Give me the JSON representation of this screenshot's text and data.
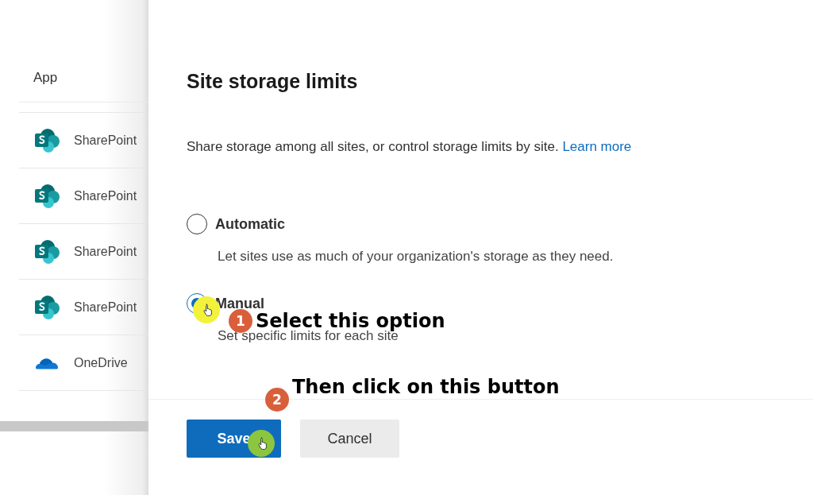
{
  "sidebar": {
    "header": "App",
    "items": [
      {
        "name": "SharePoint",
        "kind": "sharepoint"
      },
      {
        "name": "SharePoint",
        "kind": "sharepoint"
      },
      {
        "name": "SharePoint",
        "kind": "sharepoint"
      },
      {
        "name": "SharePoint",
        "kind": "sharepoint"
      },
      {
        "name": "OneDrive",
        "kind": "onedrive"
      }
    ]
  },
  "dialog": {
    "title": "Site storage limits",
    "description": "Share storage among all sites, or control storage limits by site.",
    "link": "Learn more",
    "options": [
      {
        "label": "Automatic",
        "description": "Let sites use as much of your organization's storage as they need.",
        "selected": false
      },
      {
        "label": "Manual",
        "description": "Set specific limits for each site",
        "selected": true
      }
    ],
    "buttons": [
      {
        "label": "Save",
        "kind": "primary"
      },
      {
        "label": "Cancel",
        "kind": "secondary"
      }
    ]
  },
  "annotations": [
    {
      "number": "1",
      "text": "Select this option",
      "color": "#f2f23a"
    },
    {
      "number": "2",
      "text": "Then click on this button",
      "color": "#8cc63f"
    }
  ]
}
